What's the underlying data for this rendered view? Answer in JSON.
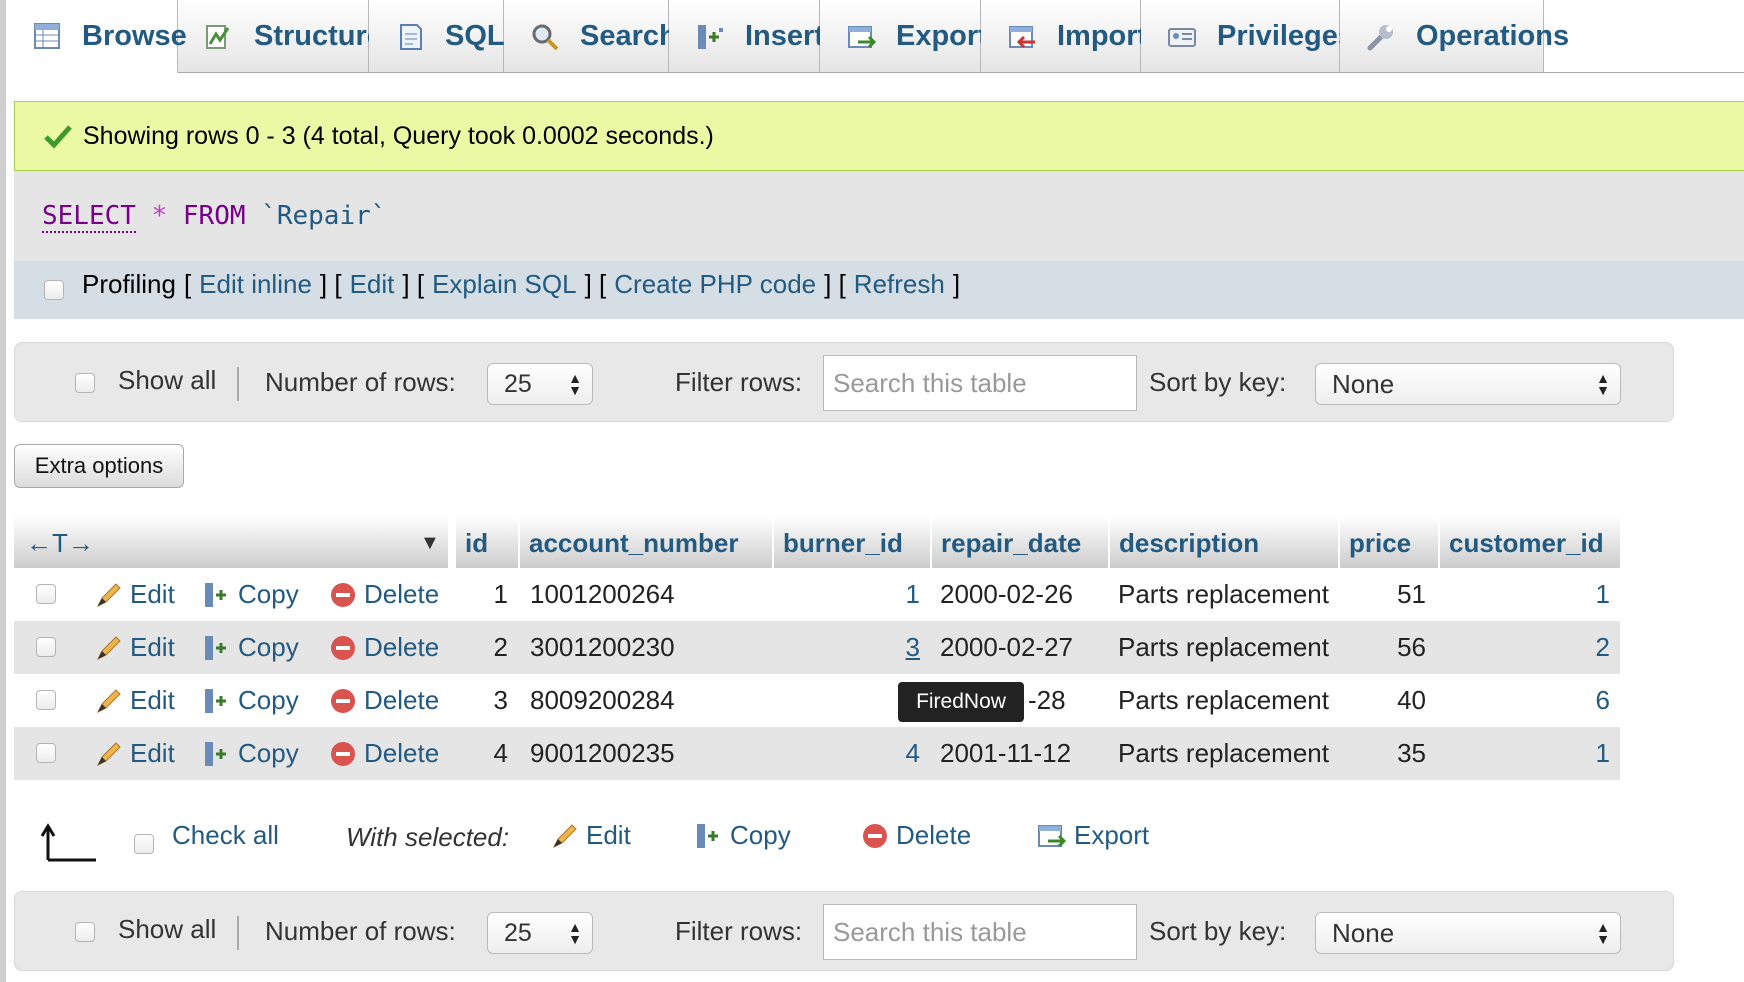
{
  "tabs": [
    {
      "label": "Browse",
      "icon": "browse-icon"
    },
    {
      "label": "Structure",
      "icon": "structure-icon"
    },
    {
      "label": "SQL",
      "icon": "sql-icon"
    },
    {
      "label": "Search",
      "icon": "search-icon"
    },
    {
      "label": "Insert",
      "icon": "insert-icon"
    },
    {
      "label": "Export",
      "icon": "export-icon"
    },
    {
      "label": "Import",
      "icon": "import-icon"
    },
    {
      "label": "Privileges",
      "icon": "privileges-icon"
    },
    {
      "label": "Operations",
      "icon": "operations-icon"
    }
  ],
  "active_tab": "Browse",
  "message": {
    "text": "Showing rows 0 - 3 (4 total, Query took 0.0002 seconds.)",
    "color": "#ebf8a4"
  },
  "query": {
    "select": "SELECT",
    "star": "*",
    "from": "FROM",
    "table": "`Repair`"
  },
  "profiling": {
    "label": "Profiling",
    "links": [
      "Edit inline",
      "Edit",
      "Explain SQL",
      "Create PHP code",
      "Refresh"
    ]
  },
  "nav": {
    "show_all": "Show all",
    "number_of_rows_label": "Number of rows:",
    "number_of_rows_value": "25",
    "filter_label": "Filter rows:",
    "filter_placeholder": "Search this table",
    "sort_label": "Sort by key:",
    "sort_value": "None"
  },
  "extra_options": "Extra options",
  "table": {
    "columns": [
      "id",
      "account_number",
      "burner_id",
      "repair_date",
      "description",
      "price",
      "customer_id"
    ],
    "action_labels": {
      "edit": "Edit",
      "copy": "Copy",
      "delete": "Delete"
    },
    "rows": [
      {
        "id": "1",
        "account_number": "1001200264",
        "burner_id": "1",
        "repair_date": "2000-02-26",
        "description": "Parts replacement",
        "price": "51",
        "customer_id": "1"
      },
      {
        "id": "2",
        "account_number": "3001200230",
        "burner_id": "3",
        "repair_date": "2000-02-27",
        "description": "Parts replacement",
        "price": "56",
        "customer_id": "2"
      },
      {
        "id": "3",
        "account_number": "8009200284",
        "burner_id": "",
        "repair_date": "-28",
        "description": "Parts replacement",
        "price": "40",
        "customer_id": "6"
      },
      {
        "id": "4",
        "account_number": "9001200235",
        "burner_id": "4",
        "repair_date": "2001-11-12",
        "description": "Parts replacement",
        "price": "35",
        "customer_id": "1"
      }
    ],
    "tooltip": "FiredNow"
  },
  "bulk": {
    "check_all": "Check all",
    "with_selected": "With selected:",
    "edit": "Edit",
    "copy": "Copy",
    "delete": "Delete",
    "export": "Export"
  },
  "colors": {
    "link": "#235a81",
    "delete_icon": "#d9534f",
    "message_border": "#a2d246"
  }
}
